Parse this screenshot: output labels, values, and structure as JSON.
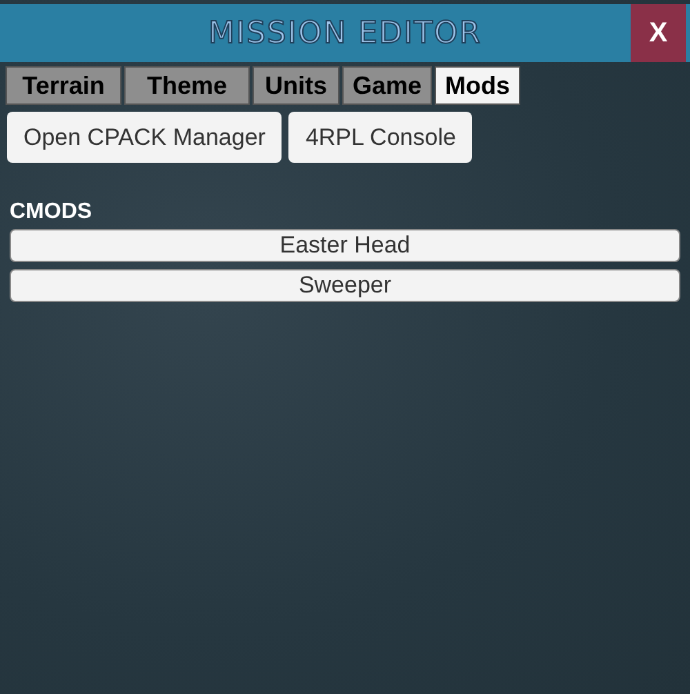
{
  "window": {
    "title": "MISSION EDITOR",
    "close": "X"
  },
  "tabs": [
    {
      "label": "Terrain",
      "selected": false
    },
    {
      "label": "Theme",
      "selected": false
    },
    {
      "label": "Units",
      "selected": false
    },
    {
      "label": "Game",
      "selected": false
    },
    {
      "label": "Mods",
      "selected": true
    }
  ],
  "buttons": [
    "Open CPACK Manager",
    "4RPL Console"
  ],
  "section": {
    "heading": "CMODS",
    "items": [
      "Easter Head",
      "Sweeper"
    ]
  }
}
